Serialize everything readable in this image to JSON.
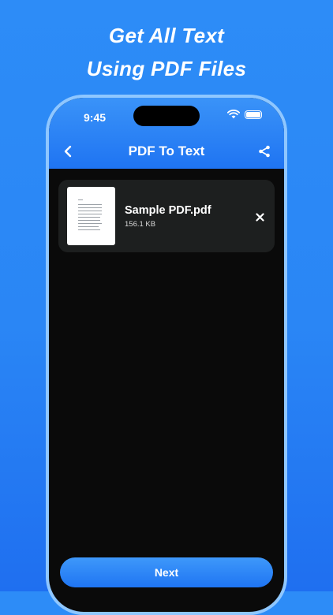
{
  "promo": {
    "line1": "Get All Text",
    "line2": "Using PDF Files"
  },
  "status_bar": {
    "time": "9:45"
  },
  "nav": {
    "title": "PDF To Text",
    "back_icon": "chevron-left-icon",
    "share_icon": "share-icon"
  },
  "file": {
    "name": "Sample PDF.pdf",
    "size": "156.1 KB",
    "remove_icon": "close-icon"
  },
  "actions": {
    "next_label": "Next"
  },
  "colors": {
    "background": "#2a86f5",
    "accent": "#1f74f2",
    "screen": "#0a0a0a",
    "card": "#1d1f1f"
  }
}
